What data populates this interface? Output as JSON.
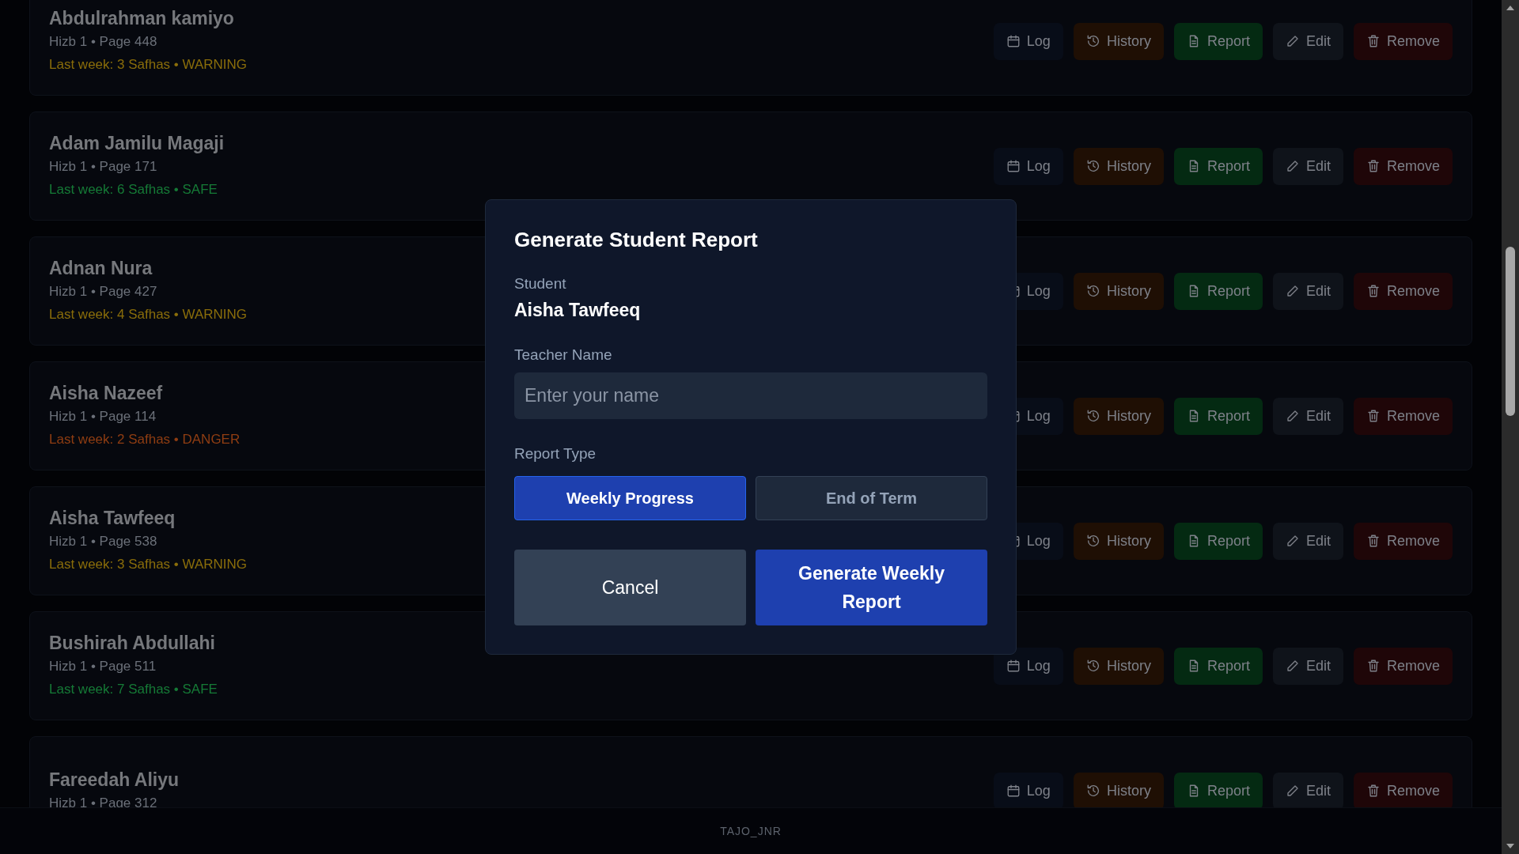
{
  "students": [
    {
      "name": "Abdulrahman kamiyo",
      "detail": "Hizb 1 • Page 448",
      "status": "Last week: 3 Safhas • WARNING",
      "color": "#8a6d0a",
      "actions": [
        {
          "label": "Log",
          "kind": "log"
        },
        {
          "label": "History",
          "kind": "history"
        },
        {
          "label": "Report",
          "kind": "report"
        },
        {
          "label": "Edit",
          "kind": "edit"
        },
        {
          "label": "Remove",
          "kind": "remove"
        }
      ]
    },
    {
      "name": "Adam Jamilu Magaji",
      "detail": "Hizb 1 • Page 171",
      "status": "Last week: 6 Safhas • SAFE",
      "color": "#157a36",
      "actions": [
        {
          "label": "Log",
          "kind": "log"
        },
        {
          "label": "History",
          "kind": "history"
        },
        {
          "label": "Report",
          "kind": "report"
        },
        {
          "label": "Edit",
          "kind": "edit"
        },
        {
          "label": "Remove",
          "kind": "remove"
        }
      ]
    },
    {
      "name": "Adnan Nura",
      "detail": "Hizb 1 • Page 427",
      "status": "Last week: 4 Safhas • WARNING",
      "color": "#8a6d0a",
      "actions": [
        {
          "label": "Log",
          "kind": "log"
        },
        {
          "label": "History",
          "kind": "history"
        },
        {
          "label": "Report",
          "kind": "report"
        },
        {
          "label": "Edit",
          "kind": "edit"
        },
        {
          "label": "Remove",
          "kind": "remove"
        }
      ]
    },
    {
      "name": "Aisha Nazeef",
      "detail": "Hizb 1 • Page 114",
      "status": "Last week: 2 Safhas • DANGER",
      "color": "#8f3d12",
      "actions": [
        {
          "label": "Log",
          "kind": "log"
        },
        {
          "label": "History",
          "kind": "history"
        },
        {
          "label": "Report",
          "kind": "report"
        },
        {
          "label": "Edit",
          "kind": "edit"
        },
        {
          "label": "Remove",
          "kind": "remove"
        }
      ]
    },
    {
      "name": "Aisha Tawfeeq",
      "detail": "Hizb 1 • Page 538",
      "status": "Last week: 3 Safhas • WARNING",
      "color": "#8a6d0a",
      "actions": [
        {
          "label": "Log",
          "kind": "log"
        },
        {
          "label": "History",
          "kind": "history"
        },
        {
          "label": "Report",
          "kind": "report"
        },
        {
          "label": "Edit",
          "kind": "edit"
        },
        {
          "label": "Remove",
          "kind": "remove"
        }
      ]
    },
    {
      "name": "Bushirah Abdullahi",
      "detail": "Hizb 1 • Page 511",
      "status": "Last week: 7 Safhas • SAFE",
      "color": "#157a36",
      "actions": [
        {
          "label": "Log",
          "kind": "log"
        },
        {
          "label": "History",
          "kind": "history"
        },
        {
          "label": "Report",
          "kind": "report"
        },
        {
          "label": "Edit",
          "kind": "edit"
        },
        {
          "label": "Remove",
          "kind": "remove"
        }
      ]
    },
    {
      "name": "Fareedah Aliyu",
      "detail": "Hizb 1 • Page 312",
      "actions": [
        {
          "label": "Log",
          "kind": "log"
        },
        {
          "label": "History",
          "kind": "history"
        },
        {
          "label": "Report",
          "kind": "report"
        },
        {
          "label": "Edit",
          "kind": "edit"
        },
        {
          "label": "Remove",
          "kind": "remove"
        }
      ]
    }
  ],
  "footer": "TAJO_JNR",
  "modal": {
    "title": "Generate Student Report",
    "student_label": "Student",
    "student_name": "Aisha Tawfeeq",
    "teacher_label": "Teacher Name",
    "teacher_field": {
      "placeholder": "Enter your name"
    },
    "report_type_label": "Report Type",
    "report_types": [
      {
        "label": "Weekly Progress",
        "selected": true
      },
      {
        "label": "End of Term",
        "selected": false
      }
    ],
    "cancel": "Cancel",
    "submit": "Generate Weekly Report"
  }
}
